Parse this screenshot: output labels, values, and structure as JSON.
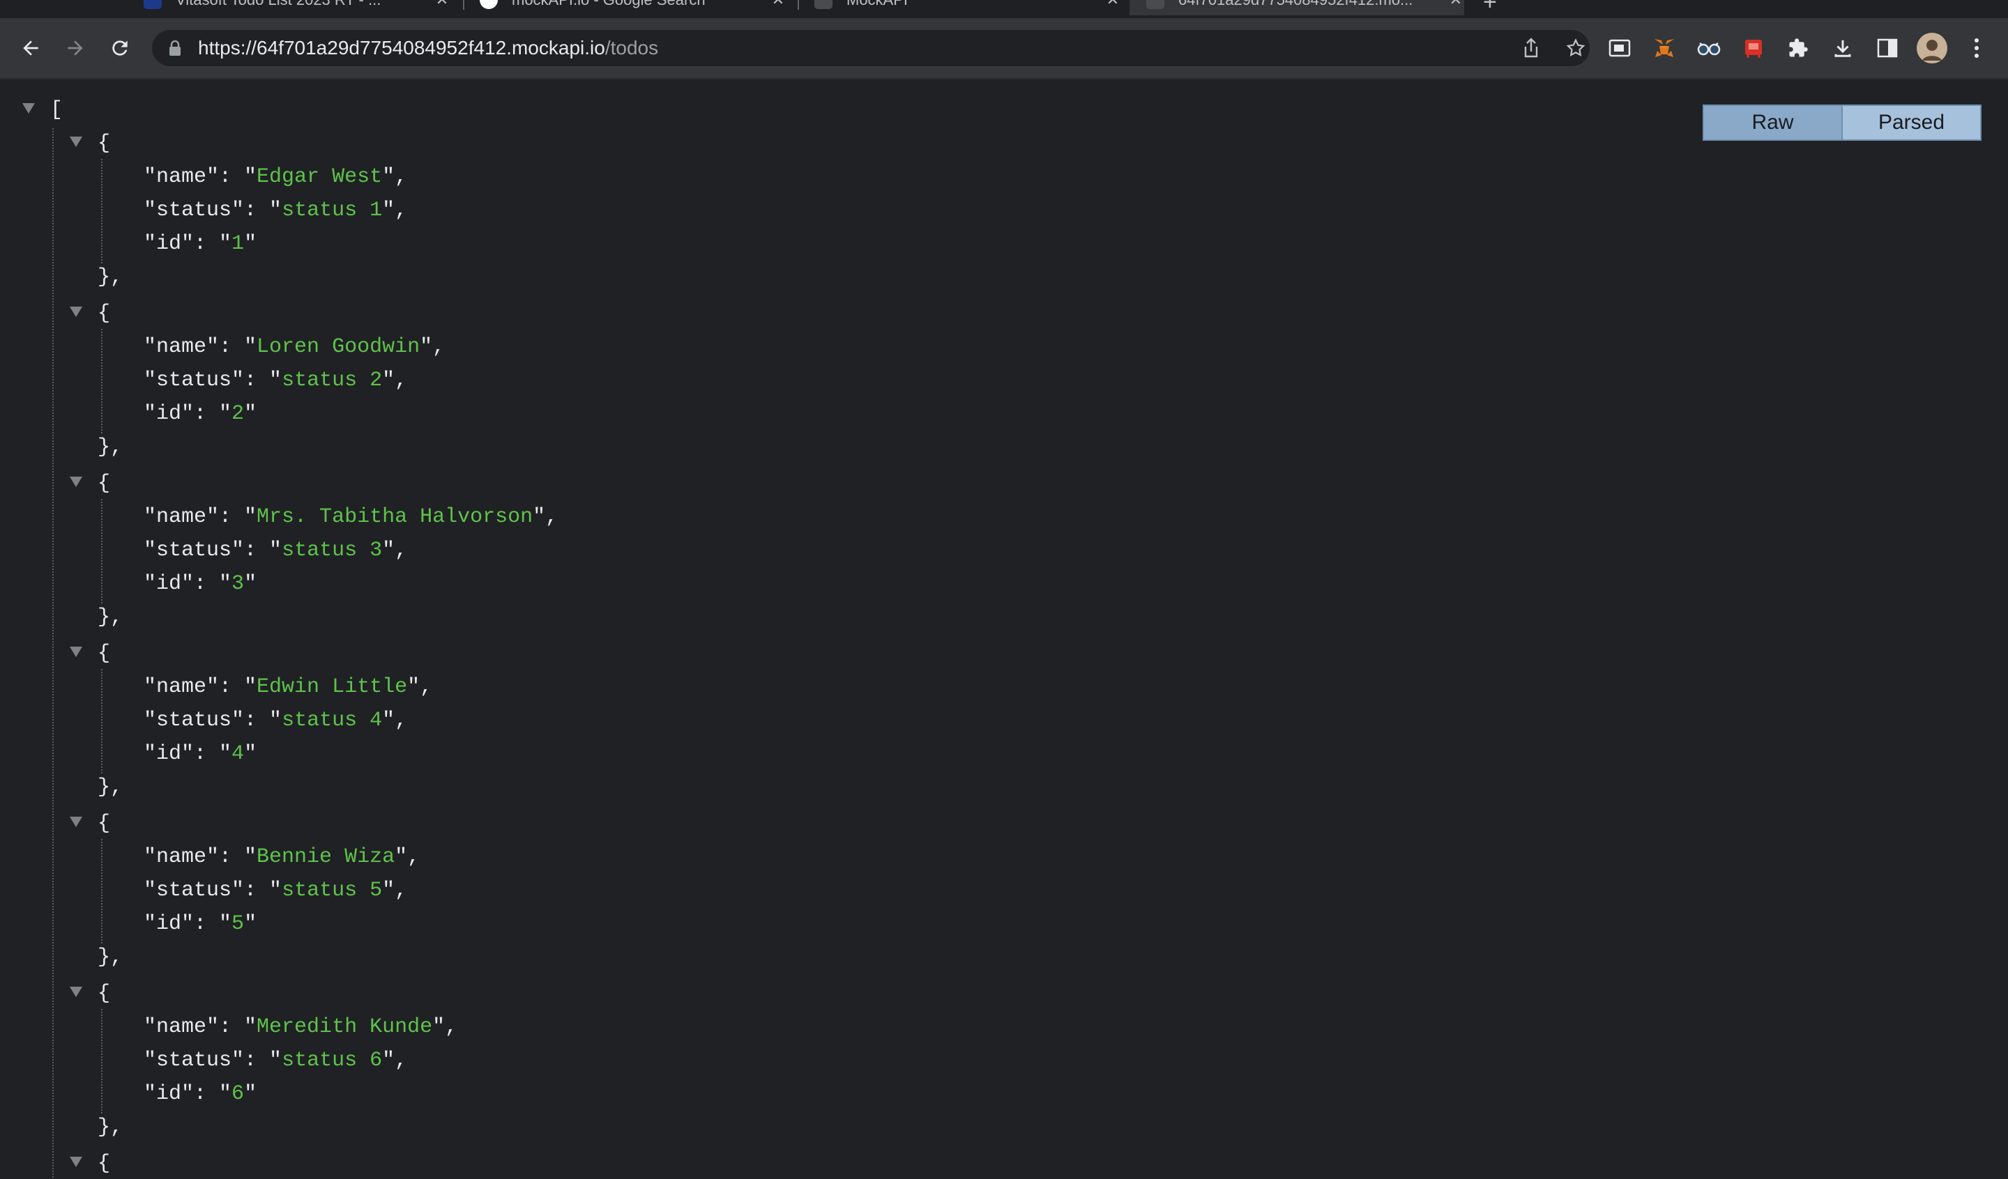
{
  "tabs": [
    {
      "title": "Vitasoft Todo List 2023 RT - ..."
    },
    {
      "title": "mockAPI.io - Google Search"
    },
    {
      "title": "MockAPI"
    },
    {
      "title": "64f701a29d7754084952f412.mo..."
    }
  ],
  "toolbar": {
    "url_host": "https://64f701a29d7754084952f412.mockapi.io",
    "url_path": "/todos"
  },
  "viewer": {
    "raw_label": "Raw",
    "parsed_label": "Parsed"
  },
  "todos": [
    {
      "name": "Edgar West",
      "status": "status 1",
      "id": "1"
    },
    {
      "name": "Loren Goodwin",
      "status": "status 2",
      "id": "2"
    },
    {
      "name": "Mrs. Tabitha Halvorson",
      "status": "status 3",
      "id": "3"
    },
    {
      "name": "Edwin Little",
      "status": "status 4",
      "id": "4"
    },
    {
      "name": "Bennie Wiza",
      "status": "status 5",
      "id": "5"
    },
    {
      "name": "Meredith Kunde",
      "status": "status 6",
      "id": "6"
    }
  ],
  "json_keys": {
    "name": "name",
    "status": "status",
    "id": "id"
  },
  "colors": {
    "background": "#202124",
    "string": "#5ec34b",
    "key": "#e8eaed",
    "toggle_raw": "#8aa9c8",
    "toggle_parsed": "#a6c1dc"
  }
}
